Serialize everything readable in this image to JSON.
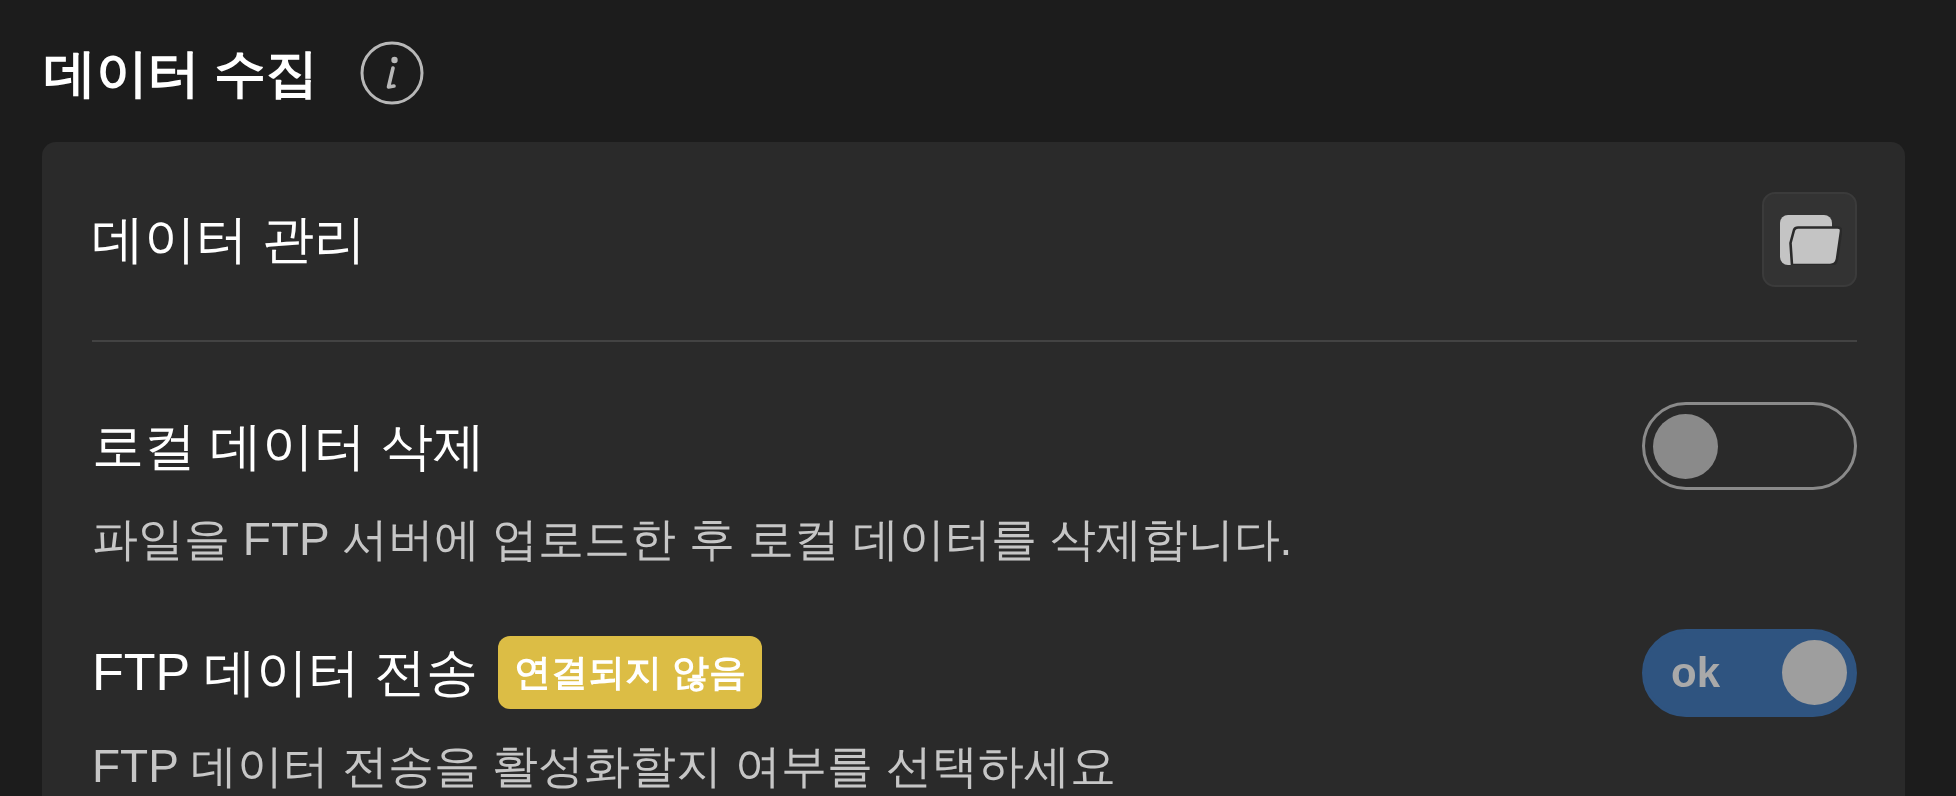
{
  "section": {
    "title": "데이터 수집"
  },
  "groups": [
    {
      "rows": [
        {
          "kind": "button",
          "title": "데이터 관리"
        }
      ]
    },
    {
      "rows": [
        {
          "kind": "toggle",
          "title": "로컬 데이터 삭제",
          "description": "파일을 FTP 서버에 업로드한 후 로컬 데이터를 삭제합니다.",
          "on": false
        },
        {
          "kind": "toggle",
          "title": "FTP 데이터 전송",
          "badge": "연결되지 않음",
          "description": "FTP 데이터 전송을 활성화할지 여부를 선택하세요",
          "on": true,
          "toggle_label": "ok"
        }
      ]
    }
  ]
}
